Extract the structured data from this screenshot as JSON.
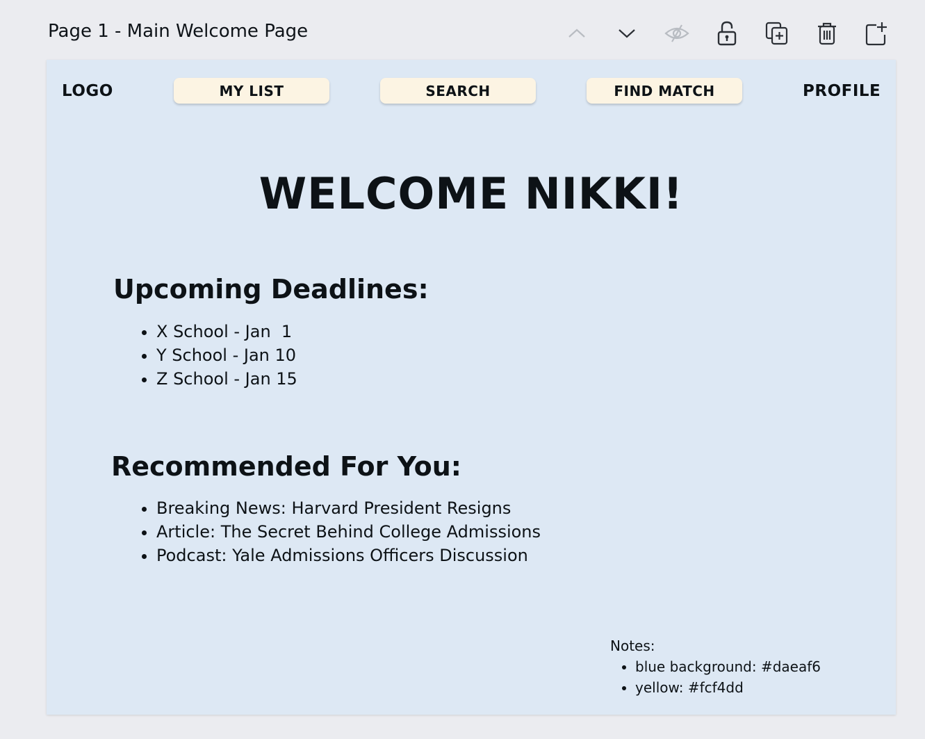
{
  "header": {
    "page_title": "Page 1 - Main Welcome Page",
    "icons": [
      "chevron-up-icon",
      "chevron-down-icon",
      "eye-hidden-icon",
      "lock-open-icon",
      "duplicate-page-icon",
      "trash-icon",
      "add-page-icon"
    ]
  },
  "canvas": {
    "background_color": "#dde8f4",
    "logo": "LOGO",
    "nav": {
      "my_list": "MY LIST",
      "search": "SEARCH",
      "find_match": "FIND MATCH",
      "profile": "PROFILE",
      "button_color": "#fcf4e3"
    },
    "welcome": "WELCOME NIKKI!",
    "deadlines": {
      "heading": "Upcoming Deadlines:",
      "items": [
        "X School - Jan  1",
        "Y School - Jan 10",
        "Z School - Jan 15"
      ]
    },
    "recommended": {
      "heading": "Recommended For You:",
      "items": [
        "Breaking News: Harvard President Resigns",
        "Article: The Secret Behind College Admissions",
        "Podcast: Yale Admissions Officers Discussion"
      ]
    },
    "notes": {
      "label": "Notes:",
      "items": [
        "blue background: #daeaf6",
        "yellow: #fcf4dd"
      ]
    }
  }
}
